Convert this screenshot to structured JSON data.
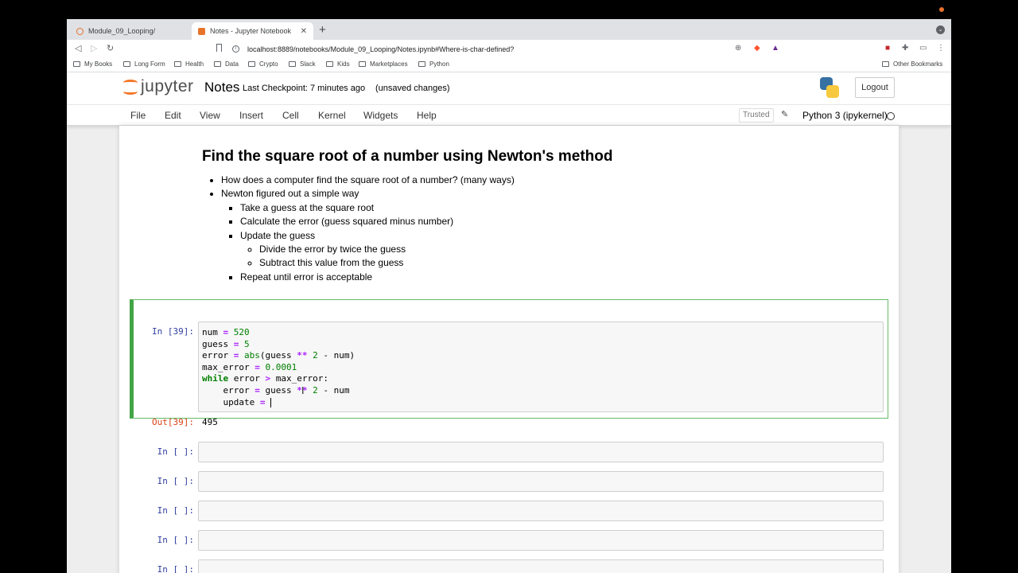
{
  "browser": {
    "tabs": [
      {
        "label": "Module_09_Looping/",
        "active": false
      },
      {
        "label": "Notes - Jupyter Notebook",
        "active": true
      }
    ],
    "new_tab": "+",
    "url": "localhost:8889/notebooks/Module_09_Looping/Notes.ipynb#Where-is-char-defined?",
    "bookmarks": [
      "My Books",
      "Long Form",
      "Health",
      "Data",
      "Crypto",
      "Slack",
      "Kids",
      "Marketplaces",
      "Python"
    ],
    "other_bookmarks": "Other Bookmarks"
  },
  "jupyter": {
    "logo_text": "jupyter",
    "notebook_title": "Notes",
    "checkpoint": "Last Checkpoint: 7 minutes ago",
    "unsaved": "(unsaved changes)",
    "logout": "Logout",
    "menu": [
      "File",
      "Edit",
      "View",
      "Insert",
      "Cell",
      "Kernel",
      "Widgets",
      "Help"
    ],
    "trusted": "Trusted",
    "kernel": "Python 3 (ipykernel)"
  },
  "markdown": {
    "heading": "Find the square root of a number using Newton's method",
    "bullets": {
      "b1": "How does a computer find the square root of a number? (many ways)",
      "b2": "Newton figured out a simple way",
      "b2_1": "Take a guess at the square root",
      "b2_2": "Calculate the error (guess squared minus number)",
      "b2_3": "Update the guess",
      "b2_3_1": "Divide the error by twice the guess",
      "b2_3_2": "Subtract this value from the guess",
      "b2_4": "Repeat until error is acceptable"
    }
  },
  "code_cell": {
    "in_prompt": "In [39]:",
    "out_prompt": "Out[39]:",
    "output": "495",
    "lines": {
      "l1": {
        "a": "num ",
        "op": "=",
        "num": " 520"
      },
      "l2": {
        "a": "guess ",
        "op": "=",
        "num": " 5"
      },
      "l3": {
        "a": "error ",
        "op": "=",
        "fn": " abs",
        "b": "(guess ",
        "op2": "**",
        "num": " 2",
        "c": " - num)"
      },
      "l4": {
        "a": "max_error ",
        "op": "=",
        "num": " 0.0001"
      },
      "l5": {
        "kw": "while",
        "a": " error ",
        "op": ">",
        "b": " max_error:"
      },
      "l6": {
        "a": "    error ",
        "op": "=",
        "b": " guess ",
        "op2": "**",
        "num": " 2",
        "c": " - num"
      },
      "l7": {
        "a": "    update ",
        "op": "=",
        "b": " "
      }
    }
  },
  "empty_cells": [
    "In [ ]:",
    "In [ ]:",
    "In [ ]:",
    "In [ ]:",
    "In [ ]:"
  ]
}
